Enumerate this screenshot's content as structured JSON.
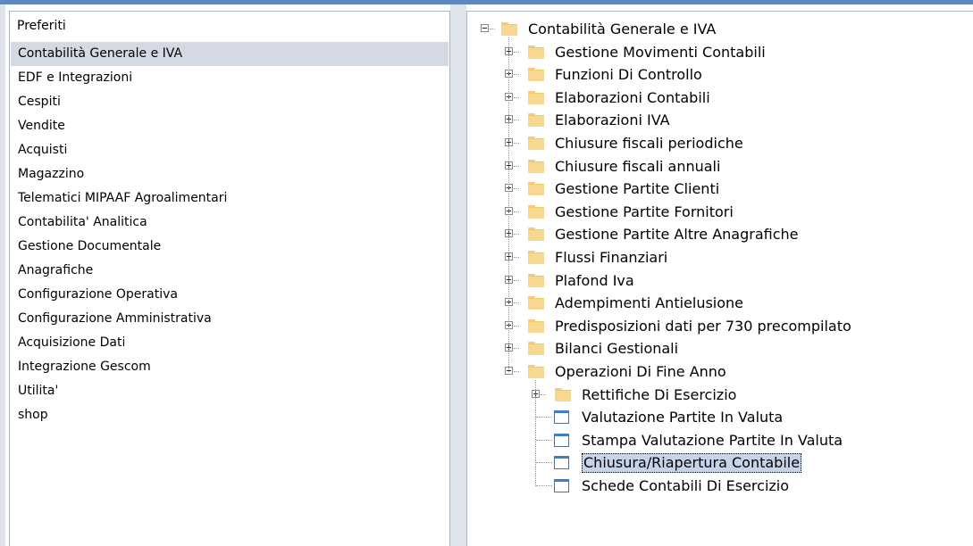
{
  "favorites": {
    "header": "Preferiti",
    "items": [
      "Contabilità Generale e IVA",
      "EDF e Integrazioni",
      "Cespiti",
      "Vendite",
      "Acquisti",
      "Magazzino",
      "Telematici MIPAAF Agroalimentari",
      "Contabilita' Analitica",
      "Gestione Documentale",
      "Anagrafiche",
      "Configurazione Operativa",
      "Configurazione Amministrativa",
      "Acquisizione Dati",
      "Integrazione Gescom",
      "Utilita'",
      "shop"
    ],
    "selected_index": 0
  },
  "tree": {
    "root": "Contabilità Generale e IVA",
    "level1": [
      "Gestione Movimenti Contabili",
      "Funzioni Di Controllo",
      "Elaborazioni Contabili",
      "Elaborazioni IVA",
      "Chiusure fiscali periodiche",
      "Chiusure fiscali annuali",
      "Gestione Partite Clienti",
      "Gestione Partite Fornitori",
      "Gestione Partite Altre Anagrafiche",
      "Flussi Finanziari",
      "Plafond Iva",
      "Adempimenti Antielusione",
      "Predisposizioni dati per 730 precompilato",
      "Bilanci Gestionali",
      "Operazioni Di Fine Anno"
    ],
    "expanded_folder": "Operazioni Di Fine Anno",
    "level2": [
      {
        "label": "Rettifiche Di Esercizio",
        "kind": "folder"
      },
      {
        "label": "Valutazione Partite In Valuta",
        "kind": "document"
      },
      {
        "label": "Stampa Valutazione Partite In Valuta",
        "kind": "document"
      },
      {
        "label": "Chiusura/Riapertura Contabile",
        "kind": "document"
      },
      {
        "label": "Schede Contabili Di Esercizio",
        "kind": "document"
      }
    ],
    "selected_item": "Chiusura/Riapertura Contabile"
  }
}
